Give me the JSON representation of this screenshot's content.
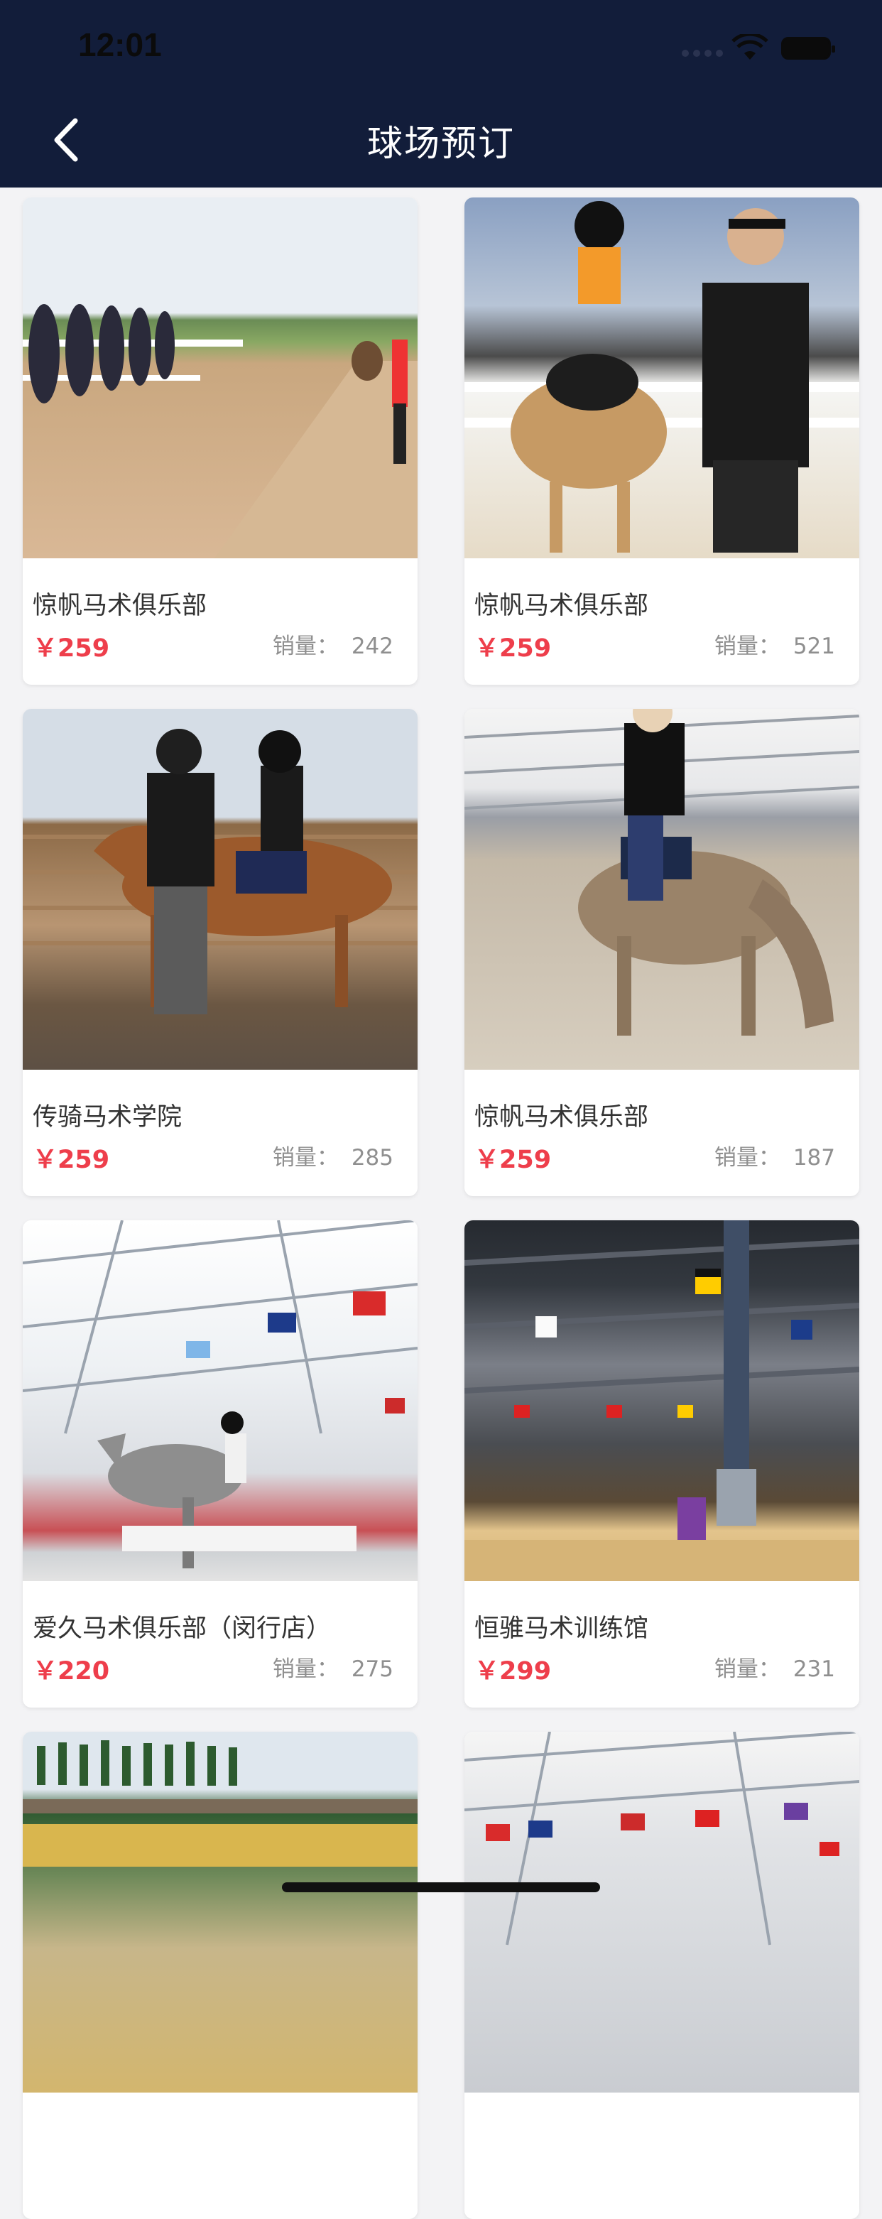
{
  "status_bar": {
    "time": "12:01"
  },
  "nav": {
    "title": "球场预订"
  },
  "sales_label": "销量：",
  "cards": [
    {
      "name": "惊帆马术俱乐部",
      "price": "￥259",
      "sales": "242"
    },
    {
      "name": "惊帆马术俱乐部",
      "price": "￥259",
      "sales": "521"
    },
    {
      "name": "传骑马术学院",
      "price": "￥259",
      "sales": "285"
    },
    {
      "name": "惊帆马术俱乐部",
      "price": "￥259",
      "sales": "187"
    },
    {
      "name": "爱久马术俱乐部（闵行店）",
      "price": "￥220",
      "sales": "275"
    },
    {
      "name": "恒骓马术训练馆",
      "price": "￥299",
      "sales": "231"
    },
    {
      "name": "",
      "price": "",
      "sales": ""
    },
    {
      "name": "",
      "price": "",
      "sales": ""
    }
  ],
  "colors": {
    "header": "#121d3a",
    "price": "#ee3e4b",
    "background": "#f3f3f5"
  }
}
